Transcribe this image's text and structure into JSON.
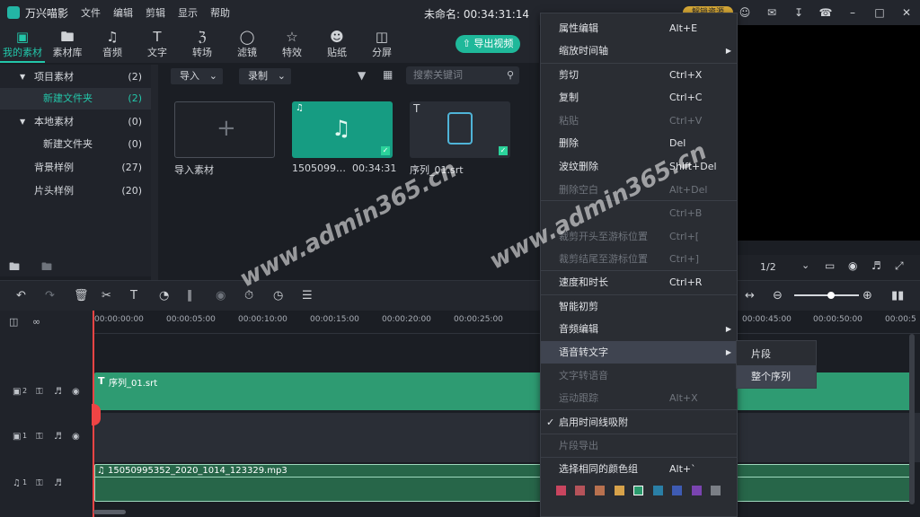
{
  "titlebar": {
    "app_name": "万兴喵影",
    "menu": [
      "文件",
      "编辑",
      "剪辑",
      "显示",
      "帮助"
    ],
    "doc_title": "未命名: 00:34:31:14",
    "unlock_label": "解锁资源"
  },
  "toolbar": {
    "items": [
      "我的素材",
      "素材库",
      "音频",
      "文字",
      "转场",
      "滤镜",
      "特效",
      "贴纸",
      "分屏"
    ],
    "export_label": "导出视频"
  },
  "tree": {
    "items": [
      {
        "label": "项目素材",
        "count": "(2)"
      },
      {
        "label": "新建文件夹",
        "count": "(2)"
      },
      {
        "label": "本地素材",
        "count": "(0)"
      },
      {
        "label": "新建文件夹",
        "count": "(0)"
      },
      {
        "label": "背景样例",
        "count": "(27)"
      },
      {
        "label": "片头样例",
        "count": "(20)"
      }
    ]
  },
  "media": {
    "import_dd": "导入",
    "record_dd": "录制",
    "search_placeholder": "搜索关键词",
    "import_label": "导入素材",
    "audio_name": "1505099…",
    "audio_duration": "00:34:31",
    "srt_name": "序列_01.srt"
  },
  "preview": {
    "zoom": "1/2"
  },
  "timeline": {
    "ticks": [
      "00:00:00:00",
      "00:00:05:00",
      "00:00:10:00",
      "00:00:15:00",
      "00:00:20:00",
      "00:00:25:00",
      "00:00:45:00",
      "00:00:50:00",
      "00:00:5"
    ],
    "srt_clip": "序列_01.srt",
    "audio_clip": "15050995352_2020_1014_123329.mp3",
    "track_labels": [
      "2",
      "1",
      "1"
    ]
  },
  "context_menu": {
    "items": [
      {
        "label": "属性编辑",
        "shortcut": "Alt+E"
      },
      {
        "label": "缩放时间轴",
        "shortcut": ""
      },
      {
        "label": "剪切",
        "shortcut": "Ctrl+X"
      },
      {
        "label": "复制",
        "shortcut": "Ctrl+C"
      },
      {
        "label": "粘贴",
        "shortcut": "Ctrl+V"
      },
      {
        "label": "删除",
        "shortcut": "Del"
      },
      {
        "label": "波纹删除",
        "shortcut": "Shift+Del"
      },
      {
        "label": "删除空白",
        "shortcut": "Alt+Del"
      },
      {
        "label": "",
        "shortcut": "Ctrl+B"
      },
      {
        "label": "裁剪开头至游标位置",
        "shortcut": "Ctrl+["
      },
      {
        "label": "裁剪结尾至游标位置",
        "shortcut": "Ctrl+]"
      },
      {
        "label": "速度和时长",
        "shortcut": "Ctrl+R"
      },
      {
        "label": "智能初剪",
        "shortcut": ""
      },
      {
        "label": "音频编辑",
        "shortcut": ""
      },
      {
        "label": "语音转文字",
        "shortcut": ""
      },
      {
        "label": "文字转语音",
        "shortcut": ""
      },
      {
        "label": "运动跟踪",
        "shortcut": "Alt+X"
      },
      {
        "label": "启用时间线吸附",
        "shortcut": ""
      },
      {
        "label": "片段导出",
        "shortcut": ""
      },
      {
        "label": "选择相同的颜色组",
        "shortcut": "Alt+`"
      }
    ],
    "submenu": [
      "片段",
      "整个序列"
    ],
    "colors": [
      "#c9455f",
      "#b5535a",
      "#b8714f",
      "#d7a24a",
      "#2b9a6d",
      "#2a7fa6",
      "#3e5bb3",
      "#7a44b0",
      "#7b7f86"
    ]
  },
  "watermark": "www.admin365.cn"
}
